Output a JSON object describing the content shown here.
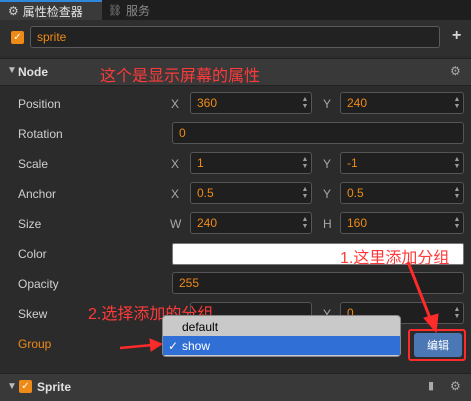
{
  "tabs": [
    {
      "label": "属性检查器",
      "icon": "gear-icon",
      "active": true
    },
    {
      "label": "服务",
      "icon": "link-icon",
      "active": false
    }
  ],
  "node_name": {
    "value": "sprite",
    "enabled": true
  },
  "node_section": {
    "title": "Node",
    "annotation": "这个是显示屏幕的属性"
  },
  "props": {
    "position": {
      "label": "Position",
      "x": "360",
      "y": "240"
    },
    "rotation": {
      "label": "Rotation",
      "value": "0"
    },
    "scale": {
      "label": "Scale",
      "x": "1",
      "y": "-1"
    },
    "anchor": {
      "label": "Anchor",
      "x": "0.5",
      "y": "0.5"
    },
    "size": {
      "label": "Size",
      "w": "240",
      "h": "160"
    },
    "color": {
      "label": "Color",
      "value": "#ffffff"
    },
    "opacity": {
      "label": "Opacity",
      "value": "255"
    },
    "skew": {
      "label": "Skew",
      "x": "",
      "y": "0"
    },
    "group": {
      "label": "Group",
      "options": [
        "default",
        "show"
      ],
      "selected": "show"
    }
  },
  "axis_labels": {
    "x": "X",
    "y": "Y",
    "w": "W",
    "h": "H"
  },
  "annotations": {
    "add_group": "1.这里添加分组",
    "select_group": "2.选择添加的分组"
  },
  "edit_button": "编辑",
  "sprite_section": {
    "title": "Sprite",
    "enabled": true
  },
  "colors": {
    "accent": "#ef8a17",
    "annotation": "#ff3a3a",
    "selection": "#2f6fd6",
    "button": "#4b78b5"
  }
}
